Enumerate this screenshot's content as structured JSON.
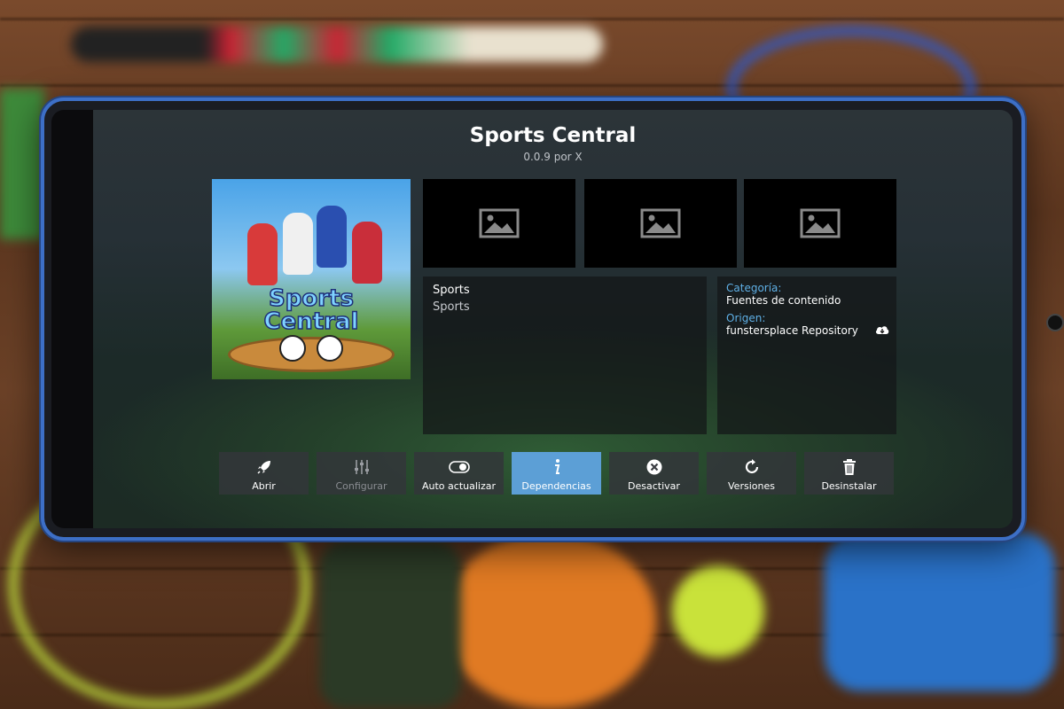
{
  "addon": {
    "title": "Sports Central",
    "subtitle": "0.0.9 por X",
    "poster_logo_line1": "Sports",
    "poster_logo_line2": "Central"
  },
  "screenshots": [
    {
      "icon": "image-placeholder-icon"
    },
    {
      "icon": "image-placeholder-icon"
    },
    {
      "icon": "image-placeholder-icon"
    }
  ],
  "description": {
    "title": "Sports",
    "summary": "Sports"
  },
  "info": {
    "category_label": "Categoría:",
    "category_value": "Fuentes de contenido",
    "origin_label": "Origen:",
    "origin_value": "funstersplace Repository",
    "origin_icon": "cloud-download-icon"
  },
  "toolbar": {
    "buttons": [
      {
        "label": "Abrir",
        "icon": "rocket-icon",
        "state": "normal"
      },
      {
        "label": "Configurar",
        "icon": "sliders-icon",
        "state": "disabled"
      },
      {
        "label": "Auto actualizar",
        "icon": "toggle-icon",
        "state": "normal"
      },
      {
        "label": "Dependencias",
        "icon": "info-icon",
        "state": "active"
      },
      {
        "label": "Desactivar",
        "icon": "close-circle-icon",
        "state": "normal"
      },
      {
        "label": "Versiones",
        "icon": "refresh-icon",
        "state": "normal"
      },
      {
        "label": "Desinstalar",
        "icon": "trash-icon",
        "state": "normal"
      }
    ]
  },
  "colors": {
    "accent": "#5c9fd6",
    "info_label": "#5fb0e6",
    "phone_frame": "#3d6fc6"
  }
}
